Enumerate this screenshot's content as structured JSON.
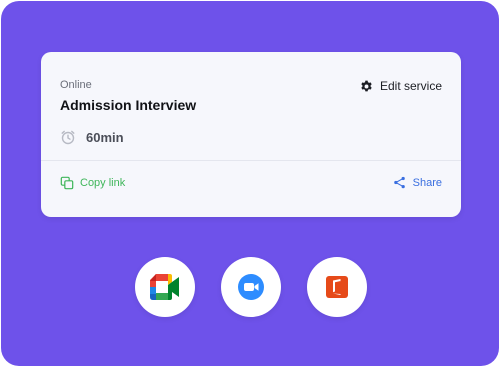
{
  "card": {
    "tag": "Online",
    "title": "Admission Interview",
    "duration": "60min",
    "edit_label": "Edit service",
    "copy_label": "Copy link",
    "share_label": "Share"
  },
  "apps": [
    {
      "name": "google-meet",
      "icon": "google-meet-icon"
    },
    {
      "name": "zoom",
      "icon": "zoom-icon"
    },
    {
      "name": "microsoft-office",
      "icon": "office-icon"
    }
  ],
  "colors": {
    "panel_bg": "#6e52ea",
    "card_bg": "#f6f7fc",
    "copy_green": "#3fb65a",
    "share_blue": "#3a6fe0",
    "zoom_blue": "#2d8cff",
    "office_red": "#e64a19"
  }
}
